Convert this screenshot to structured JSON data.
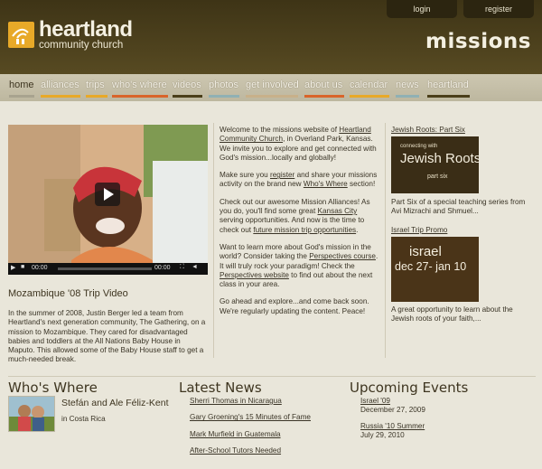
{
  "header": {
    "login": "login",
    "register": "register",
    "logo_title": "heartland",
    "logo_subtitle": "community church",
    "section": "missions"
  },
  "nav": [
    {
      "label": "home",
      "color": "#a8a38f"
    },
    {
      "label": "alliances",
      "color": "#e8a928"
    },
    {
      "label": "trips",
      "color": "#e8a928"
    },
    {
      "label": "who's where",
      "color": "#d9642a"
    },
    {
      "label": "videos",
      "color": "#4a3e1a"
    },
    {
      "label": "photos",
      "color": "#8fb0b4"
    },
    {
      "label": "get involved",
      "color": "#c8b08a"
    },
    {
      "label": "about us",
      "color": "#d9642a"
    },
    {
      "label": "calendar",
      "color": "#e8a928"
    },
    {
      "label": "news",
      "color": "#8fb0b4"
    },
    {
      "label": "heartland",
      "color": "#4a3e1a"
    }
  ],
  "video": {
    "time_left": "00:00",
    "time_right": "00:00",
    "title": "Mozambique '08 Trip Video",
    "description": "In the summer of 2008, Justin Berger led a team from Heartland's next generation community, The Gathering, on a mission to Mozambique. They cared for disadvantaged babies and toddlers at the All Nations Baby House in Maputo. This allowed some of the Baby House staff to get a much-needed break."
  },
  "welcome": {
    "p1_a": "Welcome to the missions website of ",
    "p1_link": "Heartland Community Church",
    "p1_b": ", in Overland Park, Kansas. We invite you to explore and get connected with God's mission...locally and globally!",
    "p2_a": "Make sure you ",
    "p2_link1": "register",
    "p2_b": " and share your missions activity on the brand new ",
    "p2_link2": "Who's Where",
    "p2_c": " section!",
    "p3_a": "Check out our awesome Mission Alliances! As you do, you'll find some great ",
    "p3_link1": "Kansas City",
    "p3_b": " serving opportunities. And now is the time to check out ",
    "p3_link2": "future mission trip opportunities",
    "p3_c": ".",
    "p4_a": "Want to learn more about God's mission in the world? Consider taking the ",
    "p4_link1": "Perspectives course",
    "p4_b": ". It will truly rock your paradigm! Check the ",
    "p4_link2": "Perspectives website",
    "p4_c": " to find out about the next class in your area.",
    "p5": "Go ahead and explore...and come back soon. We're regularly updating the content. Peace!"
  },
  "side": [
    {
      "title": "Jewish Roots: Part Six",
      "thumb_small": "connecting with",
      "thumb_big": "Jewish Roots",
      "thumb_part": "part six",
      "caption": "Part Six of a special teaching series from Avi Mizrachi and Shmuel..."
    },
    {
      "title": "Israel Trip Promo",
      "thumb_big": "israel",
      "thumb_dates": "dec 27- jan 10",
      "caption": "A great opportunity to learn about the Jewish roots of your faith,..."
    }
  ],
  "whos_where": {
    "heading": "Who's Where",
    "name": "Stefán and Ale Féliz-Kent",
    "place": "in Costa Rica"
  },
  "latest_news": {
    "heading": "Latest News",
    "items": [
      "Sherri Thomas in Nicaragua",
      "Gary Groening's 15 Minutes of Fame",
      "Mark Murfield in Guatemala",
      "After-School Tutors Needed"
    ]
  },
  "events": {
    "heading": "Upcoming Events",
    "items": [
      {
        "name": "Israel '09",
        "date": "December 27, 2009"
      },
      {
        "name": "Russia '10 Summer",
        "date": "July 29, 2010"
      }
    ]
  }
}
